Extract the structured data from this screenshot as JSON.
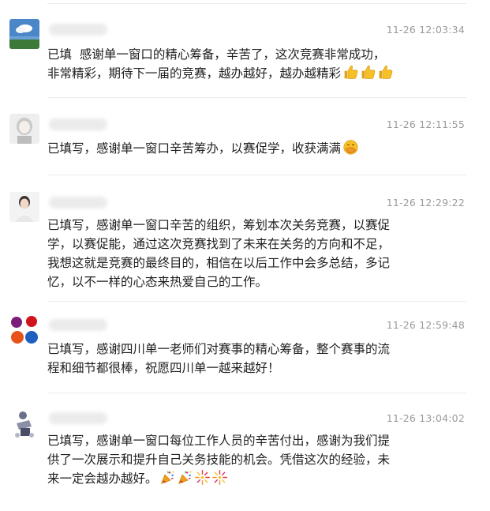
{
  "comments": [
    {
      "timestamp": "11-26 12:03:34",
      "text": "已填  感谢单一窗口的精心筹备，辛苦了，这次竞赛非常成功，\n非常精彩，期待下一届的竞赛，越办越好，越办越精彩",
      "emojis": [
        "thumbs-up",
        "thumbs-up",
        "thumbs-up"
      ]
    },
    {
      "timestamp": "11-26 12:11:55",
      "text": "已填写，感谢单一窗口辛苦筹办，以赛促学，收获满满",
      "emojis": [
        "hand-over-mouth"
      ]
    },
    {
      "timestamp": "11-26 12:29:22",
      "text": "已填写，感谢单一窗口辛苦的组织，筹划本次关务竞赛，以赛促\n学，以赛促能，通过这次竞赛找到了未来在关务的方向和不足，\n我想这就是竞赛的最终目的，相信在以后工作中会多总结，多记\n忆，以不一样的心态来热爱自己的工作。",
      "emojis": []
    },
    {
      "timestamp": "11-26 12:59:48",
      "text": "已填写，感谢四川单一老师们对赛事的精心筹备，整个赛事的流\n程和细节都很棒，祝愿四川单一越来越好！",
      "emojis": []
    },
    {
      "timestamp": "11-26 13:04:02",
      "text": "已填写，感谢单一窗口每位工作人员的辛苦付出，感谢为我们提\n供了一次展示和提升自己关务技能的机会。凭借这次的经验，未\n来一定会越办越好。",
      "emojis": [
        "party-popper",
        "party-popper",
        "fireworks",
        "fireworks"
      ]
    }
  ],
  "colors": {
    "time": "#9a9a9a",
    "divider": "#ececec",
    "text": "#1f1f1f"
  }
}
